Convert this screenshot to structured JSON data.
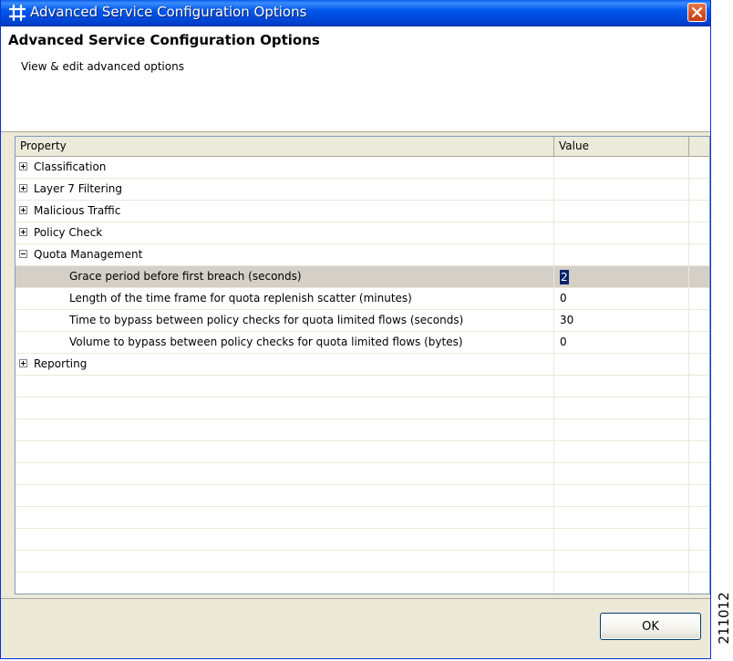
{
  "window": {
    "title": "Advanced Service Configuration Options",
    "close_symbol": "close-icon"
  },
  "header": {
    "title": "Advanced Service Configuration Options",
    "subtitle": "View & edit advanced options"
  },
  "table": {
    "columns": [
      "Property",
      "Value",
      ""
    ],
    "rows": [
      {
        "kind": "group",
        "label": "Classification",
        "expanded": false,
        "value": ""
      },
      {
        "kind": "group",
        "label": "Layer 7 Filtering",
        "expanded": false,
        "value": ""
      },
      {
        "kind": "group",
        "label": "Malicious Traffic",
        "expanded": false,
        "value": ""
      },
      {
        "kind": "group",
        "label": "Policy Check",
        "expanded": false,
        "value": ""
      },
      {
        "kind": "group",
        "label": "Quota Management",
        "expanded": true,
        "value": ""
      },
      {
        "kind": "child",
        "label": "Grace period before first breach (seconds)",
        "value": "2",
        "selected": true
      },
      {
        "kind": "child",
        "label": "Length of the time frame for quota replenish scatter (minutes)",
        "value": "0"
      },
      {
        "kind": "child",
        "label": "Time to bypass between policy checks for quota limited flows (seconds)",
        "value": "30"
      },
      {
        "kind": "child",
        "label": "Volume to bypass between policy checks for quota limited flows (bytes)",
        "value": "0"
      },
      {
        "kind": "group",
        "label": "Reporting",
        "expanded": false,
        "value": ""
      }
    ],
    "empty_rows": 11
  },
  "footer": {
    "ok_label": "OK"
  },
  "watermark": "211012",
  "colors": {
    "titlebar": "#0058ee",
    "selection": "#0a246a",
    "close_button": "#d45227"
  }
}
